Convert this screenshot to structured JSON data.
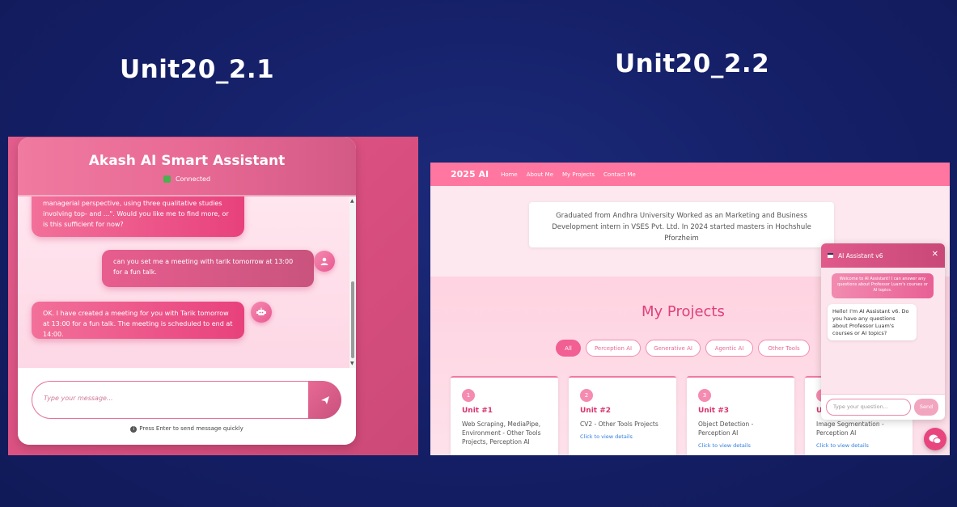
{
  "titles": {
    "left": "Unit20_2.1",
    "right": "Unit20_2.2"
  },
  "left_app": {
    "header_title": "Akash AI Smart Assistant",
    "status": "Connected",
    "messages": [
      {
        "role": "bot",
        "text": "managerial perspective, using three qualitative studies involving top- and ...\". Would you like me to find more, or is this sufficient for now?"
      },
      {
        "role": "user",
        "text": "can you set me a meeting with tarik tomorrow at 13:00 for a fun talk."
      },
      {
        "role": "bot",
        "text": "OK. I have created a meeting for you with Tarik tomorrow at 13:00 for a fun talk. The meeting is scheduled to end at 14:00."
      }
    ],
    "input_placeholder": "Type your message...",
    "hint": "Press Enter to send message quickly"
  },
  "right_app": {
    "brand": "2025 AI",
    "nav": [
      "Home",
      "About Me",
      "My Projects",
      "Contact Me"
    ],
    "about": "Graduated from Andhra University Worked as an Marketing and Business Development intern in VSES Pvt. Ltd. In 2024 started masters in Hochshule Pforzheim",
    "projects_title": "My Projects",
    "filters": [
      "All",
      "Perception AI",
      "Generative AI",
      "Agentic AI",
      "Other Tools"
    ],
    "active_filter": "All",
    "cards": [
      {
        "num": "1",
        "unit": "Unit #1",
        "desc": "Web Scraping, MediaPipe, Environment - Other Tools Projects, Perception AI",
        "link": ""
      },
      {
        "num": "2",
        "unit": "Unit #2",
        "desc": "CV2 - Other Tools Projects",
        "link": "Click to view details"
      },
      {
        "num": "3",
        "unit": "Unit #3",
        "desc": "Object Detection - Perception AI",
        "link": "Click to view details"
      },
      {
        "num": "",
        "unit": "U",
        "desc": "Image Segmentation - Perception AI",
        "link": "Click to view details"
      }
    ],
    "assistant": {
      "title": "AI Assistant v6",
      "welcome": "Welcome to AI Assistant! I can answer any questions about Professor Luam's courses or AI topics.",
      "reply": "Hello! I'm AI Assistant v6. Do you have any questions about Professor Luam's courses or AI topics?",
      "input_placeholder": "Type your question...",
      "send": "Send"
    }
  }
}
